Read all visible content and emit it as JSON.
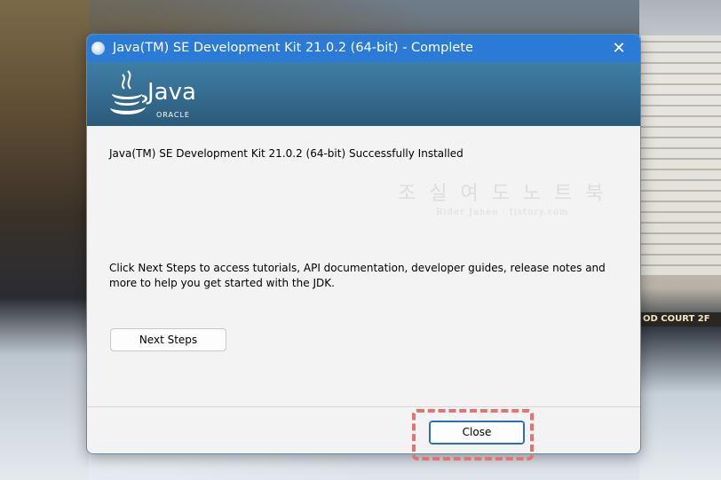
{
  "window": {
    "title": "Java(TM) SE Development Kit 21.0.2 (64-bit) - Complete",
    "close_glyph": "✕"
  },
  "banner": {
    "logo_word": "Java",
    "logo_sub": "ORACLE"
  },
  "main": {
    "installed_message": "Java(TM) SE Development Kit 21.0.2 (64-bit) Successfully Installed",
    "next_steps_message": "Click Next Steps to access tutorials, API documentation, developer guides, release notes and more to help you get started with the JDK.",
    "next_steps_label": "Next Steps"
  },
  "footer": {
    "close_label": "Close"
  },
  "watermark": {
    "line1": "조 실 여 도 노 트 북",
    "line2": "Rider Janee · tistory.com"
  },
  "background": {
    "sign_text": "OD COURT 2F"
  },
  "colors": {
    "titlebar": "#2b7bd6",
    "banner": "#34698c",
    "highlight": "#e57373",
    "focus": "#2b6cc4"
  }
}
